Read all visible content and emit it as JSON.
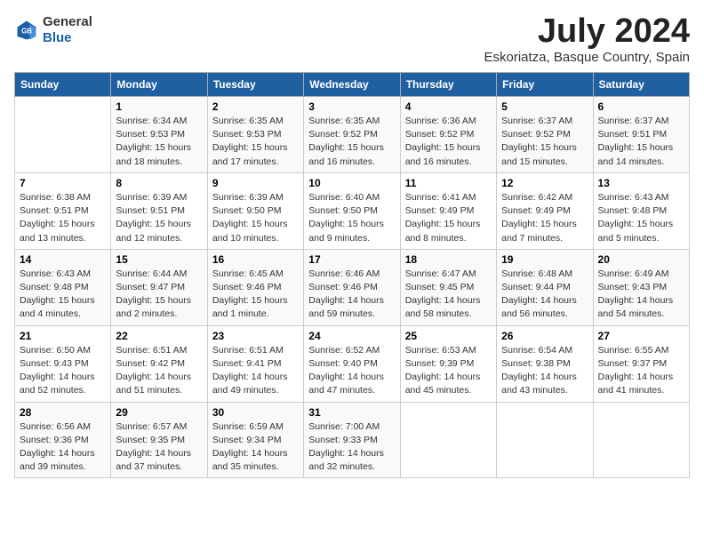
{
  "header": {
    "logo_general": "General",
    "logo_blue": "Blue",
    "month_year": "July 2024",
    "location": "Eskoriatza, Basque Country, Spain"
  },
  "days_of_week": [
    "Sunday",
    "Monday",
    "Tuesday",
    "Wednesday",
    "Thursday",
    "Friday",
    "Saturday"
  ],
  "weeks": [
    [
      {
        "day": "",
        "info": ""
      },
      {
        "day": "1",
        "info": "Sunrise: 6:34 AM\nSunset: 9:53 PM\nDaylight: 15 hours\nand 18 minutes."
      },
      {
        "day": "2",
        "info": "Sunrise: 6:35 AM\nSunset: 9:53 PM\nDaylight: 15 hours\nand 17 minutes."
      },
      {
        "day": "3",
        "info": "Sunrise: 6:35 AM\nSunset: 9:52 PM\nDaylight: 15 hours\nand 16 minutes."
      },
      {
        "day": "4",
        "info": "Sunrise: 6:36 AM\nSunset: 9:52 PM\nDaylight: 15 hours\nand 16 minutes."
      },
      {
        "day": "5",
        "info": "Sunrise: 6:37 AM\nSunset: 9:52 PM\nDaylight: 15 hours\nand 15 minutes."
      },
      {
        "day": "6",
        "info": "Sunrise: 6:37 AM\nSunset: 9:51 PM\nDaylight: 15 hours\nand 14 minutes."
      }
    ],
    [
      {
        "day": "7",
        "info": "Sunrise: 6:38 AM\nSunset: 9:51 PM\nDaylight: 15 hours\nand 13 minutes."
      },
      {
        "day": "8",
        "info": "Sunrise: 6:39 AM\nSunset: 9:51 PM\nDaylight: 15 hours\nand 12 minutes."
      },
      {
        "day": "9",
        "info": "Sunrise: 6:39 AM\nSunset: 9:50 PM\nDaylight: 15 hours\nand 10 minutes."
      },
      {
        "day": "10",
        "info": "Sunrise: 6:40 AM\nSunset: 9:50 PM\nDaylight: 15 hours\nand 9 minutes."
      },
      {
        "day": "11",
        "info": "Sunrise: 6:41 AM\nSunset: 9:49 PM\nDaylight: 15 hours\nand 8 minutes."
      },
      {
        "day": "12",
        "info": "Sunrise: 6:42 AM\nSunset: 9:49 PM\nDaylight: 15 hours\nand 7 minutes."
      },
      {
        "day": "13",
        "info": "Sunrise: 6:43 AM\nSunset: 9:48 PM\nDaylight: 15 hours\nand 5 minutes."
      }
    ],
    [
      {
        "day": "14",
        "info": "Sunrise: 6:43 AM\nSunset: 9:48 PM\nDaylight: 15 hours\nand 4 minutes."
      },
      {
        "day": "15",
        "info": "Sunrise: 6:44 AM\nSunset: 9:47 PM\nDaylight: 15 hours\nand 2 minutes."
      },
      {
        "day": "16",
        "info": "Sunrise: 6:45 AM\nSunset: 9:46 PM\nDaylight: 15 hours\nand 1 minute."
      },
      {
        "day": "17",
        "info": "Sunrise: 6:46 AM\nSunset: 9:46 PM\nDaylight: 14 hours\nand 59 minutes."
      },
      {
        "day": "18",
        "info": "Sunrise: 6:47 AM\nSunset: 9:45 PM\nDaylight: 14 hours\nand 58 minutes."
      },
      {
        "day": "19",
        "info": "Sunrise: 6:48 AM\nSunset: 9:44 PM\nDaylight: 14 hours\nand 56 minutes."
      },
      {
        "day": "20",
        "info": "Sunrise: 6:49 AM\nSunset: 9:43 PM\nDaylight: 14 hours\nand 54 minutes."
      }
    ],
    [
      {
        "day": "21",
        "info": "Sunrise: 6:50 AM\nSunset: 9:43 PM\nDaylight: 14 hours\nand 52 minutes."
      },
      {
        "day": "22",
        "info": "Sunrise: 6:51 AM\nSunset: 9:42 PM\nDaylight: 14 hours\nand 51 minutes."
      },
      {
        "day": "23",
        "info": "Sunrise: 6:51 AM\nSunset: 9:41 PM\nDaylight: 14 hours\nand 49 minutes."
      },
      {
        "day": "24",
        "info": "Sunrise: 6:52 AM\nSunset: 9:40 PM\nDaylight: 14 hours\nand 47 minutes."
      },
      {
        "day": "25",
        "info": "Sunrise: 6:53 AM\nSunset: 9:39 PM\nDaylight: 14 hours\nand 45 minutes."
      },
      {
        "day": "26",
        "info": "Sunrise: 6:54 AM\nSunset: 9:38 PM\nDaylight: 14 hours\nand 43 minutes."
      },
      {
        "day": "27",
        "info": "Sunrise: 6:55 AM\nSunset: 9:37 PM\nDaylight: 14 hours\nand 41 minutes."
      }
    ],
    [
      {
        "day": "28",
        "info": "Sunrise: 6:56 AM\nSunset: 9:36 PM\nDaylight: 14 hours\nand 39 minutes."
      },
      {
        "day": "29",
        "info": "Sunrise: 6:57 AM\nSunset: 9:35 PM\nDaylight: 14 hours\nand 37 minutes."
      },
      {
        "day": "30",
        "info": "Sunrise: 6:59 AM\nSunset: 9:34 PM\nDaylight: 14 hours\nand 35 minutes."
      },
      {
        "day": "31",
        "info": "Sunrise: 7:00 AM\nSunset: 9:33 PM\nDaylight: 14 hours\nand 32 minutes."
      },
      {
        "day": "",
        "info": ""
      },
      {
        "day": "",
        "info": ""
      },
      {
        "day": "",
        "info": ""
      }
    ]
  ]
}
